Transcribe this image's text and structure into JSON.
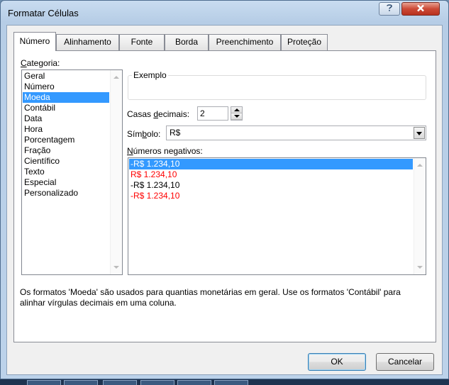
{
  "window": {
    "title": "Formatar Células"
  },
  "tabs": [
    {
      "label": "Número",
      "active": true
    },
    {
      "label": "Alinhamento",
      "active": false
    },
    {
      "label": "Fonte",
      "active": false
    },
    {
      "label": "Borda",
      "active": false
    },
    {
      "label": "Preenchimento",
      "active": false
    },
    {
      "label": "Proteção",
      "active": false
    }
  ],
  "category": {
    "label_accel": "C",
    "label_rest": "ategoria:",
    "items": [
      "Geral",
      "Número",
      "Moeda",
      "Contábil",
      "Data",
      "Hora",
      "Porcentagem",
      "Fração",
      "Científico",
      "Texto",
      "Especial",
      "Personalizado"
    ],
    "selected": "Moeda"
  },
  "sample": {
    "legend": "Exemplo",
    "value": ""
  },
  "decimals": {
    "label_pre": "Casas ",
    "label_accel": "d",
    "label_post": "ecimais:",
    "value": "2"
  },
  "symbol": {
    "label_pre": "Sím",
    "label_accel": "b",
    "label_post": "olo:",
    "value": "R$"
  },
  "negatives": {
    "label_accel": "N",
    "label_rest": "úmeros negativos:",
    "items": [
      {
        "text": "-R$ 1.234,10",
        "color": "#000000",
        "selected": true
      },
      {
        "text": "R$ 1.234,10",
        "color": "#ff0000",
        "selected": false
      },
      {
        "text": "-R$ 1.234,10",
        "color": "#000000",
        "selected": false
      },
      {
        "text": "-R$ 1.234,10",
        "color": "#ff0000",
        "selected": false
      }
    ]
  },
  "description": "Os formatos 'Moeda' são usados para quantias monetárias em geral. Use os formatos 'Contábil' para alinhar vírgulas decimais em uma coluna.",
  "buttons": {
    "ok": "OK",
    "cancel": "Cancelar"
  },
  "icons": {
    "help": "help-icon",
    "close": "close-icon"
  },
  "colors": {
    "selection": "#3399ff",
    "negative_red": "#ff0000"
  }
}
